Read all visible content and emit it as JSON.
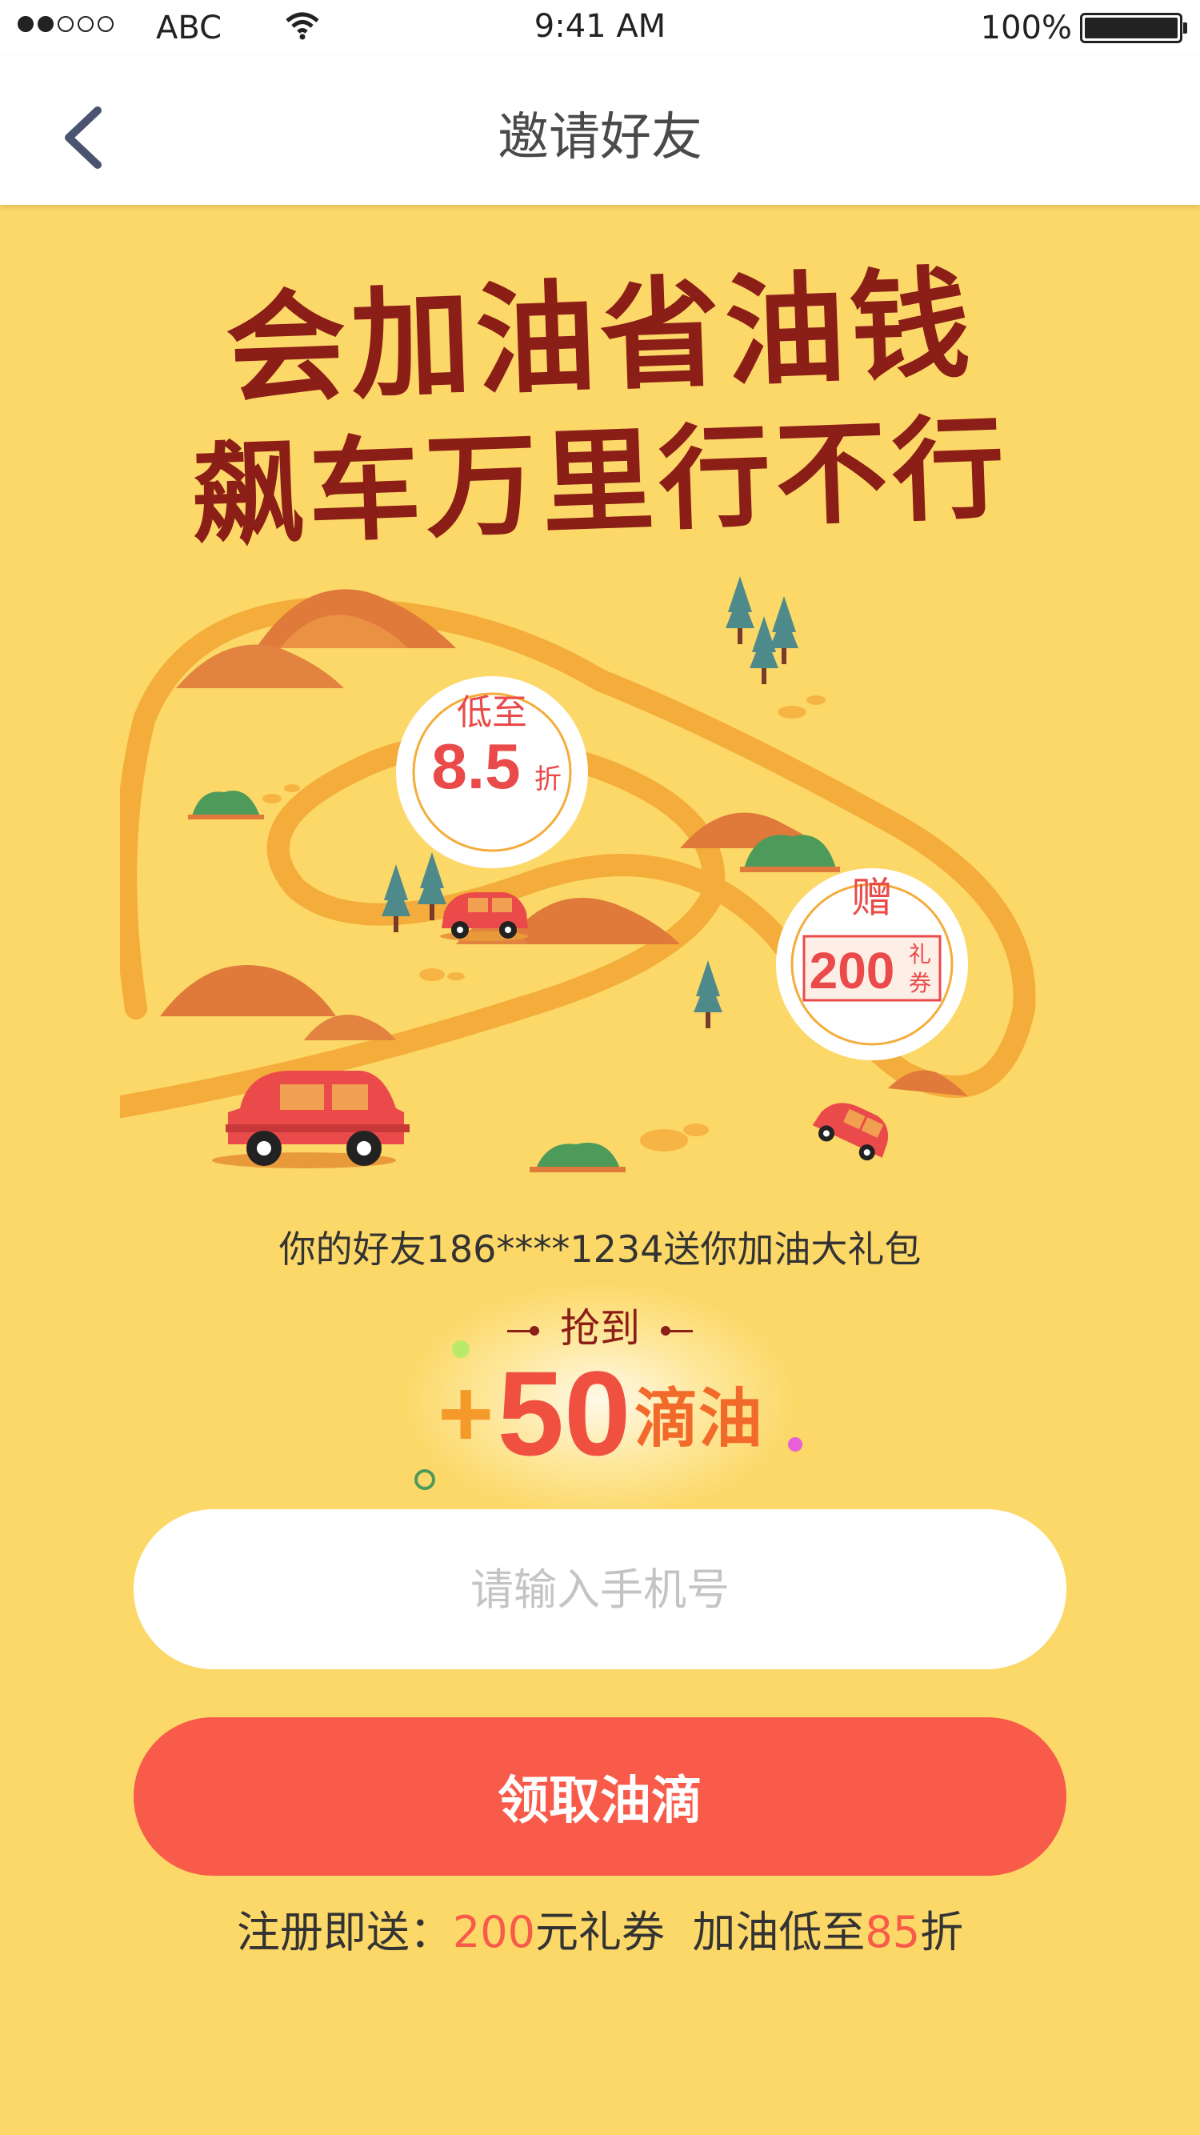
{
  "status_bar": {
    "carrier": "ABC",
    "time": "9:41 AM",
    "battery": "100%"
  },
  "nav": {
    "title": "邀请好友"
  },
  "headline": {
    "line1": "会加油省油钱",
    "line2": "飙车万里行不行"
  },
  "bubbles": {
    "discount_top": "低至",
    "discount_value": "8.5",
    "discount_unit": "折",
    "gift_top": "赠",
    "gift_value": "200",
    "gift_unit_1": "礼",
    "gift_unit_2": "券"
  },
  "invite": {
    "text": "你的好友186****1234送你加油大礼包"
  },
  "reward": {
    "caption": "抢到",
    "plus": "+",
    "amount": "50",
    "unit": "滴油"
  },
  "form": {
    "phone_placeholder": "请输入手机号",
    "phone_value": "",
    "submit_label": "领取油滴"
  },
  "promo": {
    "prefix": "注册即送：",
    "coupon_value": "200",
    "coupon_suffix": "元礼券",
    "fuel_prefix": "加油低至",
    "fuel_value": "85",
    "fuel_suffix": "折"
  },
  "colors": {
    "background": "#fcd868",
    "headline": "#8b1f18",
    "accent_red": "#f85b4a",
    "road": "#f4ac3a"
  }
}
